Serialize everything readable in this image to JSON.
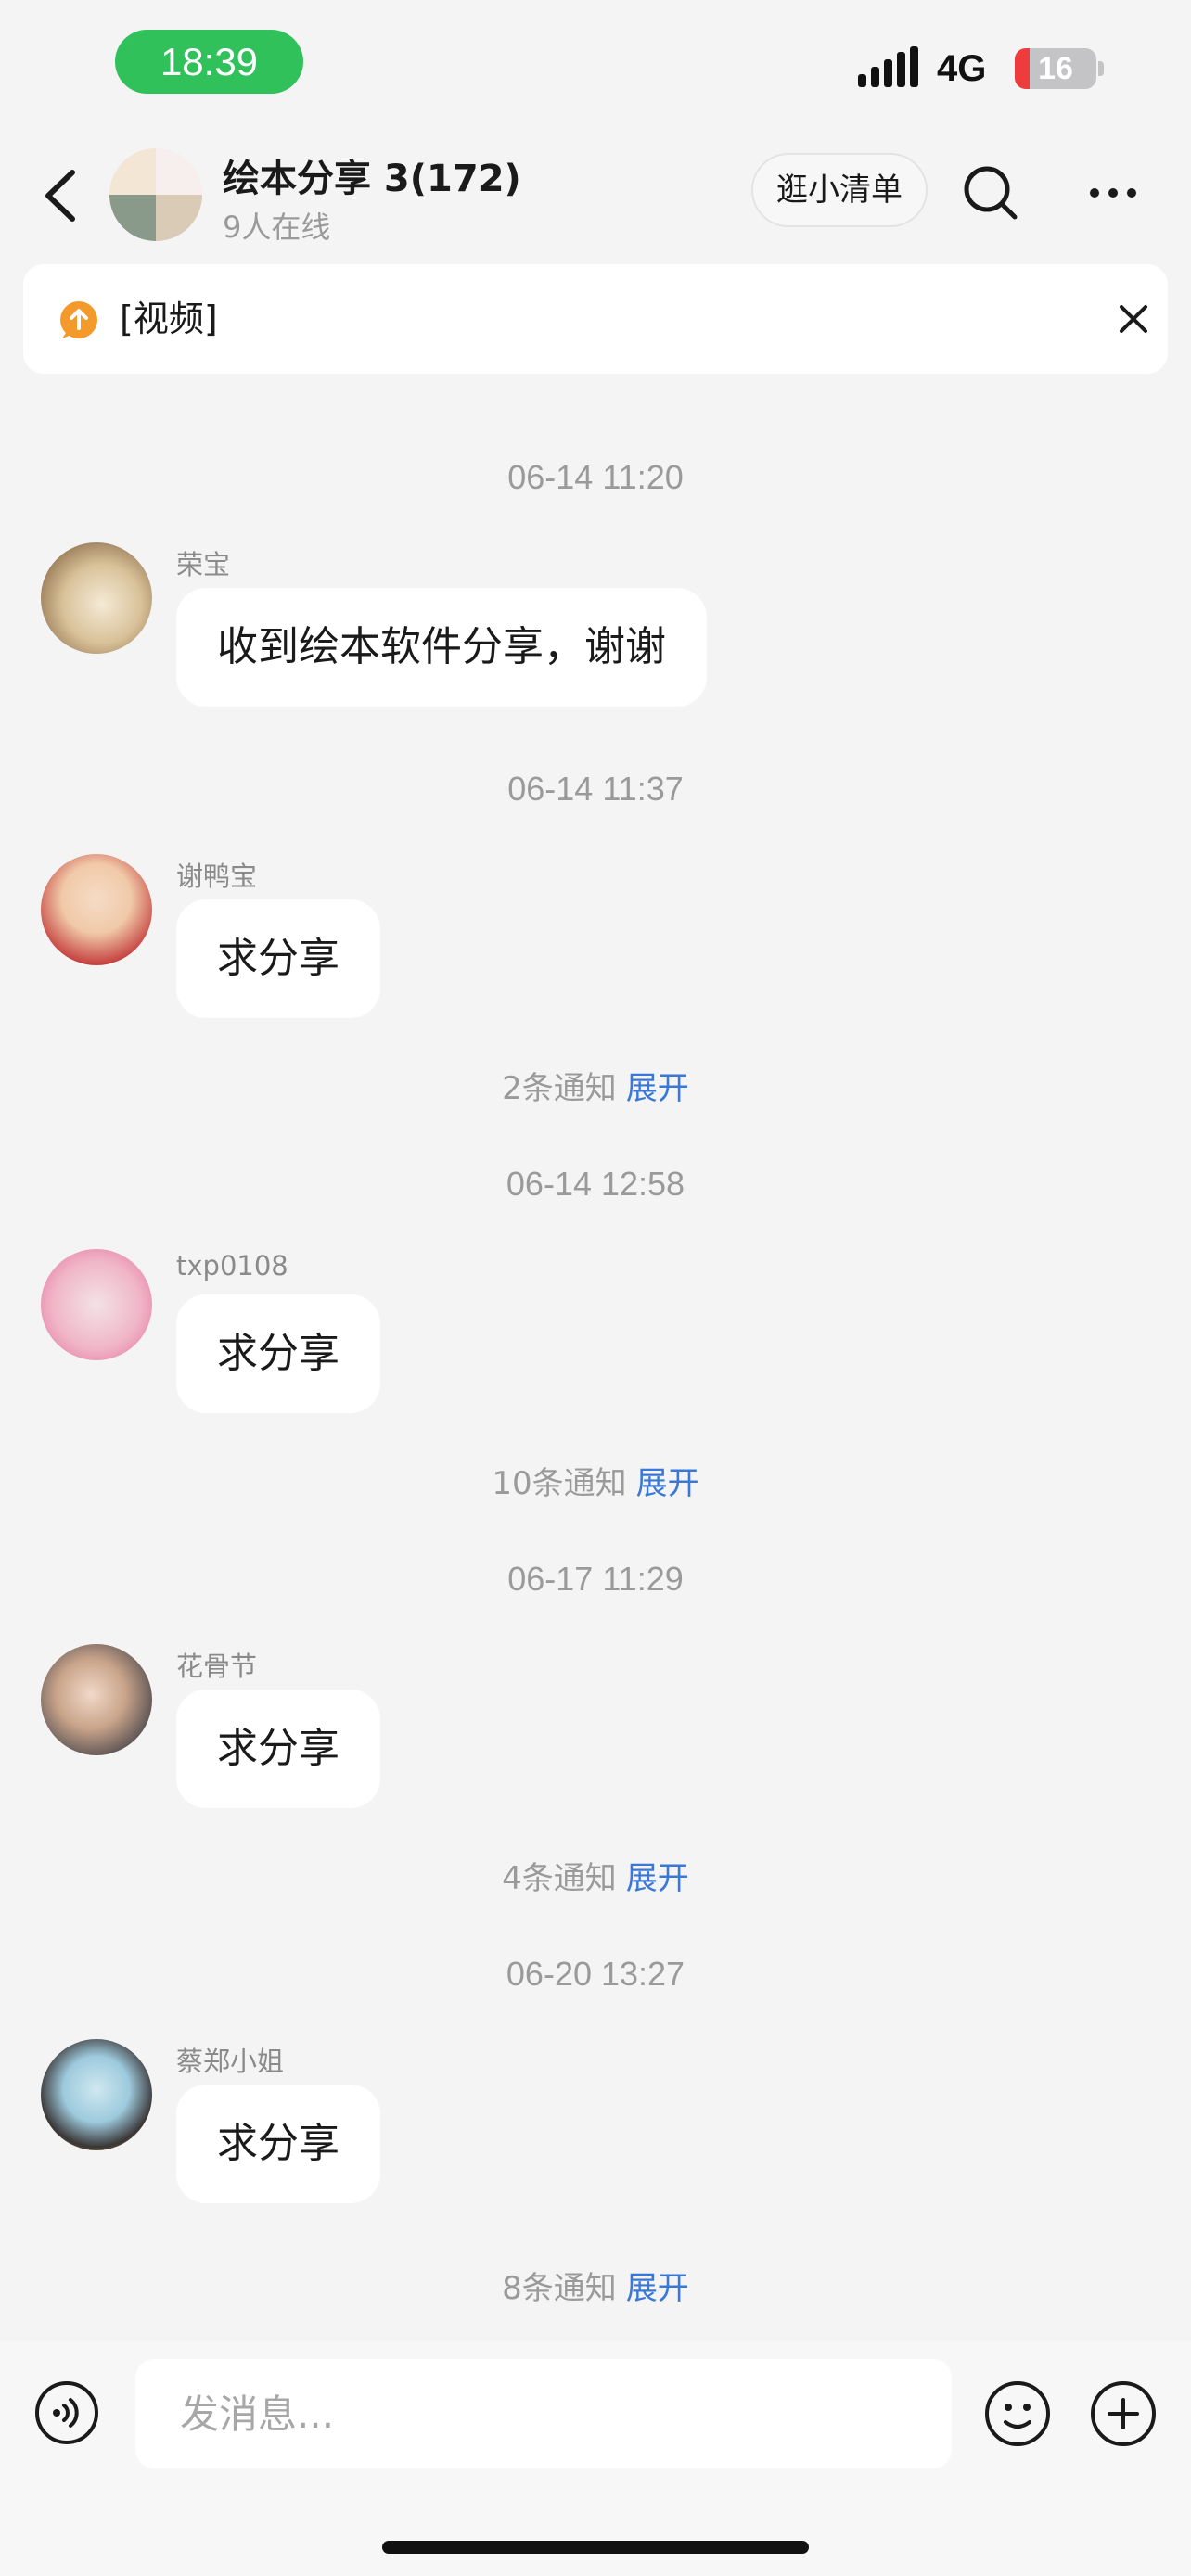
{
  "status_bar": {
    "time": "18:39",
    "network": "4G",
    "battery": "16",
    "battery_level": 0.16
  },
  "header": {
    "title": "绘本分享 3(172)",
    "subtitle": "9人在线",
    "shop_label": "逛小清单"
  },
  "pinned": {
    "text": "[视频]"
  },
  "messages": [
    {
      "time": "06-14 11:20",
      "sender": "荣宝",
      "text": "收到绘本软件分享，谢谢"
    },
    {
      "time": "06-14 11:37",
      "sender": "谢鸭宝",
      "text": "求分享",
      "notice": "2条通知",
      "expand": "展开"
    },
    {
      "time": "06-14 12:58",
      "sender": "txp0108",
      "text": "求分享",
      "notice": "10条通知",
      "expand": "展开"
    },
    {
      "time": "06-17 11:29",
      "sender": "花骨节",
      "text": "求分享",
      "notice": "4条通知",
      "expand": "展开"
    },
    {
      "time": "06-20 13:27",
      "sender": "蔡郑小姐",
      "text": "求分享",
      "notice": "8条通知",
      "expand": "展开"
    }
  ],
  "input": {
    "placeholder": "发消息..."
  },
  "colors": {
    "accent_green": "#30c15a",
    "link_blue": "#3a78d8",
    "background": "#f4f4f5"
  },
  "icons": [
    "back-icon",
    "search-icon",
    "more-icon",
    "upload-icon",
    "close-icon",
    "voice-icon",
    "emoji-icon",
    "plus-icon"
  ]
}
